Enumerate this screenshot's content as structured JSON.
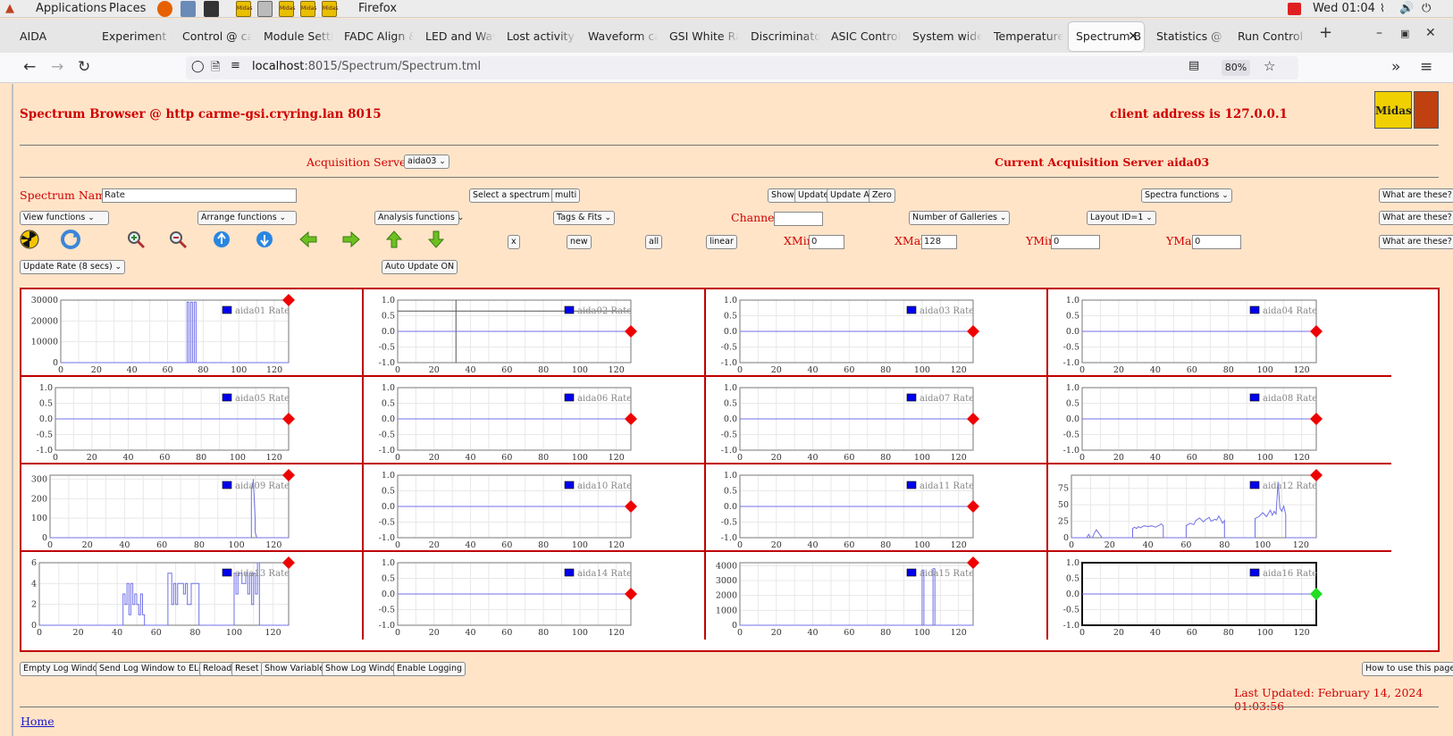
{
  "topbar": {
    "applications": "Applications",
    "places": "Places",
    "active_app": "Firefox",
    "clock": "Wed 01:04",
    "launcher_label": "Midas"
  },
  "tabs": [
    {
      "label": "AIDA"
    },
    {
      "label": "Experiment C"
    },
    {
      "label": "Control @ ca"
    },
    {
      "label": "Module Setti"
    },
    {
      "label": "FADC Align &"
    },
    {
      "label": "LED and Wav"
    },
    {
      "label": "Lost activity r"
    },
    {
      "label": "Waveform ca"
    },
    {
      "label": "GSI White Ra"
    },
    {
      "label": "Discriminator"
    },
    {
      "label": "ASIC Control"
    },
    {
      "label": "System wide"
    },
    {
      "label": "Temperature"
    },
    {
      "label": "Spectrum B"
    },
    {
      "label": "Statistics @"
    },
    {
      "label": "Run Control ("
    }
  ],
  "nav": {
    "url_host": "localhost",
    "url_rest": ":8015/Spectrum/Spectrum.tml",
    "zoom": "80%"
  },
  "page": {
    "title": "Spectrum Browser @ http carme-gsi.cryring.lan 8015",
    "client": "client address is 127.0.0.1",
    "acq_label": "Acquisition Servers",
    "acq_value": "aida03",
    "current_server": "Current Acquisition Server aida03",
    "spectrum_name_label": "Spectrum Name:",
    "spectrum_name_value": "Rate",
    "select_spectrum": "Select a spectrum",
    "multi": "multi",
    "show": "Show",
    "update": "Update",
    "update_all": "Update All",
    "zero": "Zero",
    "spectra_functions": "Spectra functions",
    "what1": "What are these?",
    "what2": "What are these?",
    "what3": "What are these?",
    "view_functions": "View functions",
    "arrange_functions": "Arrange functions",
    "analysis_functions": "Analysis functions",
    "tags_fits": "Tags & Fits",
    "channel_label": "Channel:",
    "channel_value": "",
    "num_galleries": "Number of Galleries",
    "layout": "Layout ID=1",
    "x_btn": "x",
    "new_btn": "new",
    "all_btn": "all",
    "linear_btn": "linear",
    "xmin_label": "XMin",
    "xmin": "0",
    "xmax_label": "XMax",
    "xmax": "128",
    "ymin_label": "YMin",
    "ymin": "0",
    "ymax_label": "YMax",
    "ymax": "0",
    "update_rate": "Update Rate (8 secs)",
    "auto_update": "Auto Update ON",
    "empty_log": "Empty Log Window",
    "send_log": "Send Log Window to ELog",
    "reload": "Reload",
    "reset": "Reset",
    "show_vars": "Show Variables",
    "show_log": "Show Log Window",
    "enable_logging": "Enable Logging",
    "how_to": "How to use this page",
    "last_updated": "Last Updated: February 14, 2024 01:03:56",
    "home": "Home"
  },
  "colors": {
    "page_bg": "#ffe4c8",
    "red": "#d00000",
    "line": "#7070e8",
    "marker": "#ee0000",
    "marker_ok": "#22dd22"
  },
  "chart_data": [
    {
      "type": "line",
      "legend": "aida01 Rate",
      "xlim": [
        0,
        128
      ],
      "yticks": [
        0,
        10000,
        20000,
        30000
      ],
      "ylim": [
        0,
        30000
      ],
      "series": [
        {
          "x": [
            0,
            71,
            71,
            72,
            72,
            73,
            73,
            74,
            74,
            75,
            75,
            76,
            76,
            128
          ],
          "y": [
            0,
            0,
            29000,
            29000,
            0,
            0,
            29000,
            29000,
            0,
            0,
            29000,
            29000,
            0,
            0
          ]
        }
      ],
      "status": "red"
    },
    {
      "type": "line",
      "legend": "aida02 Rate",
      "xlim": [
        0,
        128
      ],
      "yticks": [
        -1.0,
        -0.5,
        0.0,
        0.5,
        1.0
      ],
      "ylim": [
        -1,
        1
      ],
      "series": [
        {
          "x": [
            0,
            128
          ],
          "y": [
            0,
            0
          ]
        }
      ],
      "cursor": {
        "x": 32,
        "y": 0.65
      },
      "status": "red"
    },
    {
      "type": "line",
      "legend": "aida03 Rate",
      "xlim": [
        0,
        128
      ],
      "yticks": [
        -1.0,
        -0.5,
        0.0,
        0.5,
        1.0
      ],
      "ylim": [
        -1,
        1
      ],
      "series": [
        {
          "x": [
            0,
            128
          ],
          "y": [
            0,
            0
          ]
        }
      ],
      "status": "red"
    },
    {
      "type": "line",
      "legend": "aida04 Rate",
      "xlim": [
        0,
        128
      ],
      "yticks": [
        -1.0,
        -0.5,
        0.0,
        0.5,
        1.0
      ],
      "ylim": [
        -1,
        1
      ],
      "series": [
        {
          "x": [
            0,
            128
          ],
          "y": [
            0,
            0
          ]
        }
      ],
      "status": "red"
    },
    {
      "type": "line",
      "legend": "aida05 Rate",
      "xlim": [
        0,
        128
      ],
      "yticks": [
        -1.0,
        -0.5,
        0.0,
        0.5,
        1.0
      ],
      "ylim": [
        -1,
        1
      ],
      "series": [
        {
          "x": [
            0,
            128
          ],
          "y": [
            0,
            0
          ]
        }
      ],
      "status": "red"
    },
    {
      "type": "line",
      "legend": "aida06 Rate",
      "xlim": [
        0,
        128
      ],
      "yticks": [
        -1.0,
        -0.5,
        0.0,
        0.5,
        1.0
      ],
      "ylim": [
        -1,
        1
      ],
      "series": [
        {
          "x": [
            0,
            128
          ],
          "y": [
            0,
            0
          ]
        }
      ],
      "status": "red"
    },
    {
      "type": "line",
      "legend": "aida07 Rate",
      "xlim": [
        0,
        128
      ],
      "yticks": [
        -1.0,
        -0.5,
        0.0,
        0.5,
        1.0
      ],
      "ylim": [
        -1,
        1
      ],
      "series": [
        {
          "x": [
            0,
            128
          ],
          "y": [
            0,
            0
          ]
        }
      ],
      "status": "red"
    },
    {
      "type": "line",
      "legend": "aida08 Rate",
      "xlim": [
        0,
        128
      ],
      "yticks": [
        -1.0,
        -0.5,
        0.0,
        0.5,
        1.0
      ],
      "ylim": [
        -1,
        1
      ],
      "series": [
        {
          "x": [
            0,
            128
          ],
          "y": [
            0,
            0
          ]
        }
      ],
      "status": "red"
    },
    {
      "type": "line",
      "legend": "aida09 Rate",
      "xlim": [
        0,
        128
      ],
      "yticks": [
        0,
        100,
        200,
        300
      ],
      "ylim": [
        0,
        320
      ],
      "series": [
        {
          "x": [
            0,
            108,
            108,
            109,
            109,
            110,
            110,
            111,
            128
          ],
          "y": [
            0,
            0,
            250,
            290,
            300,
            100,
            30,
            0,
            0
          ]
        }
      ],
      "status": "red"
    },
    {
      "type": "line",
      "legend": "aida10 Rate",
      "xlim": [
        0,
        128
      ],
      "yticks": [
        -1.0,
        -0.5,
        0.0,
        0.5,
        1.0
      ],
      "ylim": [
        -1,
        1
      ],
      "series": [
        {
          "x": [
            0,
            128
          ],
          "y": [
            0,
            0
          ]
        }
      ],
      "status": "red"
    },
    {
      "type": "line",
      "legend": "aida11 Rate",
      "xlim": [
        0,
        128
      ],
      "yticks": [
        -1.0,
        -0.5,
        0.0,
        0.5,
        1.0
      ],
      "ylim": [
        -1,
        1
      ],
      "series": [
        {
          "x": [
            0,
            128
          ],
          "y": [
            0,
            0
          ]
        }
      ],
      "status": "red"
    },
    {
      "type": "line",
      "legend": "aida12 Rate",
      "xlim": [
        0,
        128
      ],
      "yticks": [
        0,
        25,
        50,
        75
      ],
      "ylim": [
        0,
        95
      ],
      "series": [
        {
          "x": [
            0,
            8,
            9,
            10,
            11,
            12,
            13,
            14,
            15,
            16,
            17,
            18,
            32,
            32,
            33,
            34,
            35,
            36,
            38,
            40,
            42,
            44,
            46,
            47,
            48,
            48,
            60,
            60,
            62,
            64,
            65,
            67,
            69,
            70,
            72,
            73,
            75,
            76,
            77,
            78,
            79,
            80,
            80,
            96,
            96,
            98,
            100,
            102,
            104,
            105,
            106,
            107,
            108,
            109,
            110,
            111,
            112,
            112,
            128
          ],
          "y": [
            0,
            0,
            5,
            0,
            0,
            7,
            12,
            8,
            4,
            0,
            0,
            0,
            0,
            14,
            16,
            14,
            17,
            15,
            18,
            17,
            18,
            16,
            19,
            21,
            18,
            0,
            0,
            18,
            22,
            20,
            26,
            30,
            24,
            27,
            31,
            25,
            28,
            27,
            33,
            28,
            22,
            26,
            0,
            0,
            29,
            32,
            38,
            32,
            42,
            34,
            40,
            36,
            85,
            45,
            40,
            48,
            35,
            0,
            0
          ]
        }
      ],
      "status": "red"
    },
    {
      "type": "line",
      "legend": "aida13 Rate",
      "xlim": [
        0,
        128
      ],
      "yticks": [
        0,
        2,
        4,
        6
      ],
      "ylim": [
        0,
        6
      ],
      "series": [
        {
          "x": [
            0,
            43,
            43,
            44,
            44,
            45,
            45,
            46,
            46,
            47,
            47,
            48,
            48,
            49,
            49,
            50,
            50,
            51,
            51,
            52,
            52,
            53,
            53,
            54,
            54,
            66,
            66,
            68,
            68,
            69,
            69,
            70,
            70,
            71,
            71,
            74,
            74,
            75,
            75,
            76,
            76,
            78,
            78,
            82,
            82,
            83,
            83,
            100,
            100,
            101,
            101,
            102,
            102,
            104,
            104,
            106,
            106,
            107,
            107,
            108,
            108,
            109,
            109,
            110,
            110,
            111,
            111,
            112,
            112,
            113,
            113,
            128
          ],
          "y": [
            0,
            0,
            3,
            3,
            2,
            2,
            4,
            4,
            1,
            1,
            4,
            4,
            2,
            2,
            3,
            3,
            2,
            2,
            1,
            1,
            3,
            3,
            1,
            1,
            0,
            0,
            5,
            5,
            2,
            2,
            4,
            4,
            2,
            2,
            4,
            4,
            3,
            3,
            4,
            4,
            2,
            2,
            4,
            4,
            0,
            0,
            0,
            0,
            5,
            5,
            3,
            3,
            5,
            5,
            4,
            4,
            5,
            5,
            3,
            3,
            5,
            5,
            2,
            2,
            5,
            5,
            3,
            3,
            6,
            6,
            0,
            0
          ]
        }
      ],
      "status": "red"
    },
    {
      "type": "line",
      "legend": "aida14 Rate",
      "xlim": [
        0,
        128
      ],
      "yticks": [
        -1.0,
        -0.5,
        0.0,
        0.5,
        1.0
      ],
      "ylim": [
        -1,
        1
      ],
      "series": [
        {
          "x": [
            0,
            128
          ],
          "y": [
            0,
            0
          ]
        }
      ],
      "status": "red"
    },
    {
      "type": "line",
      "legend": "aida15 Rate",
      "xlim": [
        0,
        128
      ],
      "yticks": [
        0,
        1000,
        2000,
        3000,
        4000
      ],
      "ylim": [
        0,
        4200
      ],
      "series": [
        {
          "x": [
            0,
            100,
            100,
            101,
            101,
            106,
            106,
            107,
            107,
            128
          ],
          "y": [
            0,
            0,
            3700,
            3700,
            0,
            0,
            3800,
            3800,
            0,
            0
          ]
        }
      ],
      "status": "red"
    },
    {
      "type": "line",
      "legend": "aida16 Rate",
      "xlim": [
        0,
        128
      ],
      "yticks": [
        -1.0,
        -0.5,
        0.0,
        0.5,
        1.0
      ],
      "ylim": [
        -1,
        1
      ],
      "series": [
        {
          "x": [
            0,
            128
          ],
          "y": [
            0,
            0
          ]
        }
      ],
      "status": "green",
      "selected": true
    }
  ]
}
